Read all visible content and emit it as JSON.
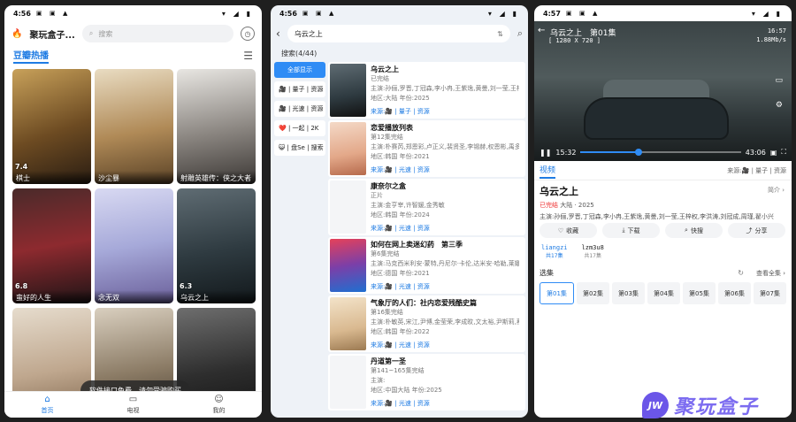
{
  "colors": {
    "accent": "#1e7be3",
    "accent_bright": "#2f8cf5",
    "finished_red": "#e33333",
    "watermark": "#6b56e8"
  },
  "phone1": {
    "status": {
      "time": "4:56",
      "left_icons": "▣ ▣ ▲",
      "right_icons": "▾ ◢ ▮"
    },
    "app_title": "聚玩盒子...",
    "logo_icon": "flame-icon",
    "search_placeholder": "搜索",
    "section_title": "豆瓣热播",
    "cards": [
      {
        "rating": "7.4",
        "caption": "棋士"
      },
      {
        "rating": "",
        "caption": "沙尘暴"
      },
      {
        "rating": "",
        "caption": "射雕英雄传：侠之大者"
      },
      {
        "rating": "6.8",
        "caption": "蛮好的人生"
      },
      {
        "rating": "",
        "caption": "念无双"
      },
      {
        "rating": "6.3",
        "caption": "乌云之上"
      },
      {
        "rating": "",
        "caption": ""
      },
      {
        "rating": "",
        "caption": ""
      },
      {
        "rating": "",
        "caption": ""
      }
    ],
    "toast": "软件接口免费，请勿受骗购买",
    "nav": [
      {
        "label": "首页",
        "icon": "home-icon"
      },
      {
        "label": "电视",
        "icon": "tv-icon"
      },
      {
        "label": "我的",
        "icon": "user-icon"
      }
    ]
  },
  "phone2": {
    "status": {
      "time": "4:56",
      "left_icons": "▣ ▣ ▲",
      "right_icons": "▾ ◢ ▮"
    },
    "query": "乌云之上",
    "count": "搜索(4/44)",
    "filters": [
      "全部显示",
      "🎥 | 量子 | 资源",
      "🎥 | 光速 | 资源",
      "❤️ | 一起 | 2K",
      "😺 | 盘Se | 搜索"
    ],
    "results": [
      {
        "title": "乌云之上",
        "status": "已完结",
        "cast": "主演:孙俪,罗晋,丁冠森,李小冉,王紫逸,黄曼,刘一莹,王梓权",
        "region": "地区:大陆 年份:2025",
        "sources": "来源:🎥 | 量子 | 资源"
      },
      {
        "title": "恋爱播放列表",
        "status": "第12集完结",
        "cast": "主演:朴赛芮,郑恩彩,卢正义,裴贤圣,李锡赫,权恩彬,禹多善",
        "region": "地区:韩国 年份:2021",
        "sources": "来源:🎥 | 光速 | 资源"
      },
      {
        "title": "康奈尔之盒",
        "status": "正片",
        "cast": "主演:金亨宰,许智媛,金秀敏",
        "region": "地区:韩国 年份:2024",
        "sources": "来源:🎥 | 光速 | 资源"
      },
      {
        "title": "如何在网上卖迷幻药　第三季",
        "status": "第6集完结",
        "cast": "主演:马克西米利安·蒙特,丹尼尔·卡伦,达米安·哈勒,莱娜",
        "region": "地区:德国 年份:2021",
        "sources": "来源:🎥 | 光速 | 资源"
      },
      {
        "title": "气象厅的人们：社内恋爱残酷史篇",
        "status": "第16集完结",
        "cast": "主演:朴敏英,宋江,尹博,金莹荣,李成旼,文太裕,尹斯莉,蔡妍",
        "region": "地区:韩国 年份:2022",
        "sources": "来源:🎥 | 光速 | 资源"
      },
      {
        "title": "丹道第一圣",
        "status": "第141~165集完结",
        "cast": "主演:",
        "region": "地区:中国大陆 年份:2025",
        "sources": "来源:🎥 | 光速 | 资源"
      }
    ]
  },
  "phone3": {
    "status": {
      "time": "4:57",
      "left_icons": "▣ ▣ ▲",
      "right_icons": "▾ ◢ ▮"
    },
    "video_title": "乌云之上　第01集",
    "resolution": "[ 1280 X 720 ]",
    "clock": "16:57",
    "speed": "1.88Mb/s",
    "current_time": "15:32",
    "total_time": "43:06",
    "progress": 0.36,
    "tab": "视频",
    "source_label": "来源:🎥 | 量子 | 资源",
    "title": "乌云之上",
    "intro_label": "简介 ›",
    "finished": "已完结",
    "meta_rest": "大陆 · 2025",
    "cast": "主演:孙俪,罗晋,丁冠森,李小冉,王紫逸,黄曼,刘一莹,王梓权,李洪涛,刘冠成,周瑾,翟小兴",
    "actions": [
      {
        "label": "收藏",
        "icon": "heart-icon"
      },
      {
        "label": "下载",
        "icon": "download-icon"
      },
      {
        "label": "快搜",
        "icon": "search-icon"
      },
      {
        "label": "分享",
        "icon": "share-icon"
      }
    ],
    "lines": [
      {
        "name": "liangzi",
        "sub": "共17集"
      },
      {
        "name": "lzm3u8",
        "sub": "共17集"
      }
    ],
    "ep_head": "选集",
    "ep_all": "查看全集 ›",
    "episodes": [
      "第01集",
      "第02集",
      "第03集",
      "第04集",
      "第05集",
      "第06集",
      "第07集"
    ]
  },
  "watermark": {
    "badge": "JW",
    "text": "聚玩盒子"
  }
}
